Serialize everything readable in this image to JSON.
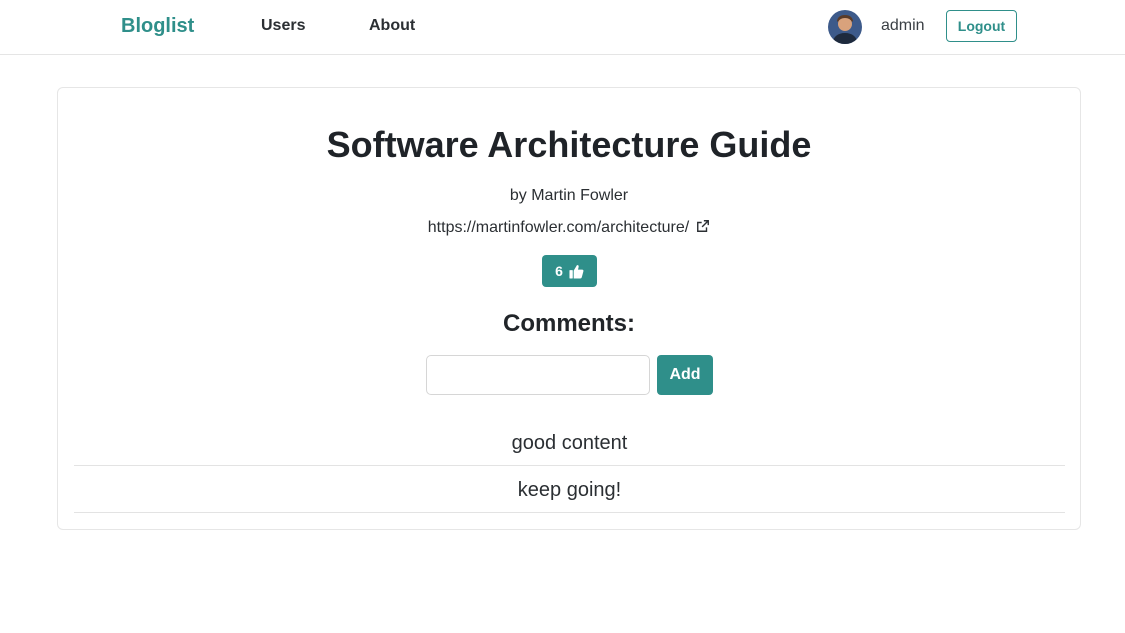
{
  "nav": {
    "brand": "Bloglist",
    "links": [
      {
        "label": "Users"
      },
      {
        "label": "About"
      }
    ],
    "user": {
      "name": "admin",
      "avatar_icon": "user-avatar-icon"
    },
    "logout_label": "Logout"
  },
  "blog": {
    "title": "Software Architecture Guide",
    "author_line": "by Martin Fowler",
    "url": "https://martinfowler.com/architecture/",
    "url_icon": "external-link-icon",
    "likes": "6",
    "like_icon": "thumbs-up-icon"
  },
  "comments": {
    "heading": "Comments:",
    "input_value": "",
    "input_placeholder": "",
    "add_label": "Add",
    "items": [
      {
        "text": "good content"
      },
      {
        "text": "keep going!"
      }
    ]
  },
  "colors": {
    "accent": "#2f8f8a",
    "text": "#212529",
    "border": "#e6e6e6"
  }
}
